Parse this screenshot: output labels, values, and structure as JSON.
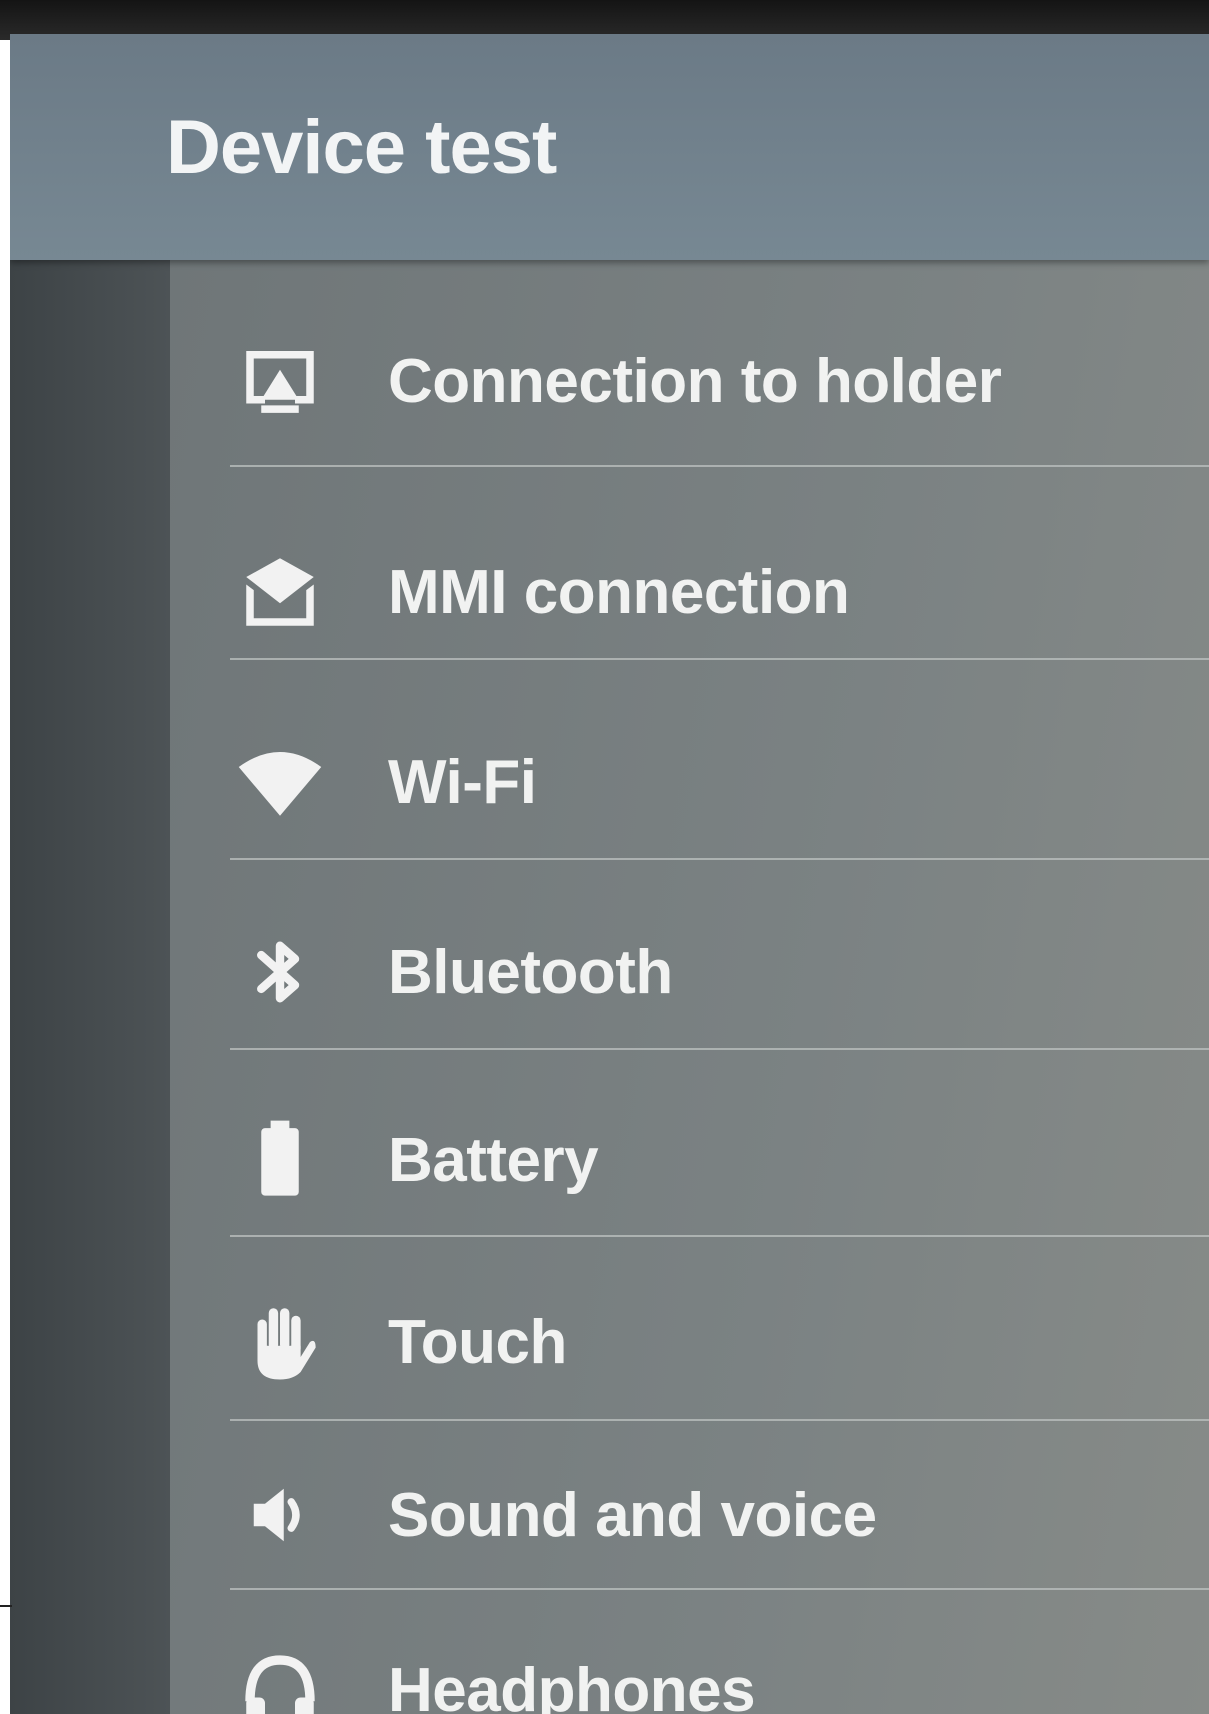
{
  "header": {
    "title": "Device test"
  },
  "menu": {
    "items": [
      {
        "label": "Connection to holder",
        "icon": "cast-icon"
      },
      {
        "label": "MMI connection",
        "icon": "mmi-connection-icon"
      },
      {
        "label": "Wi-Fi",
        "icon": "wifi-icon"
      },
      {
        "label": "Bluetooth",
        "icon": "bluetooth-icon"
      },
      {
        "label": "Battery",
        "icon": "battery-icon"
      },
      {
        "label": "Touch",
        "icon": "hand-icon"
      },
      {
        "label": "Sound and voice",
        "icon": "speaker-icon"
      },
      {
        "label": "Headphones",
        "icon": "headphones-icon"
      }
    ]
  },
  "colors": {
    "header_bg": "#6b7a86",
    "panel_bg": "#7b8283",
    "text": "#f1f2f1",
    "divider": "#b9bebd"
  }
}
